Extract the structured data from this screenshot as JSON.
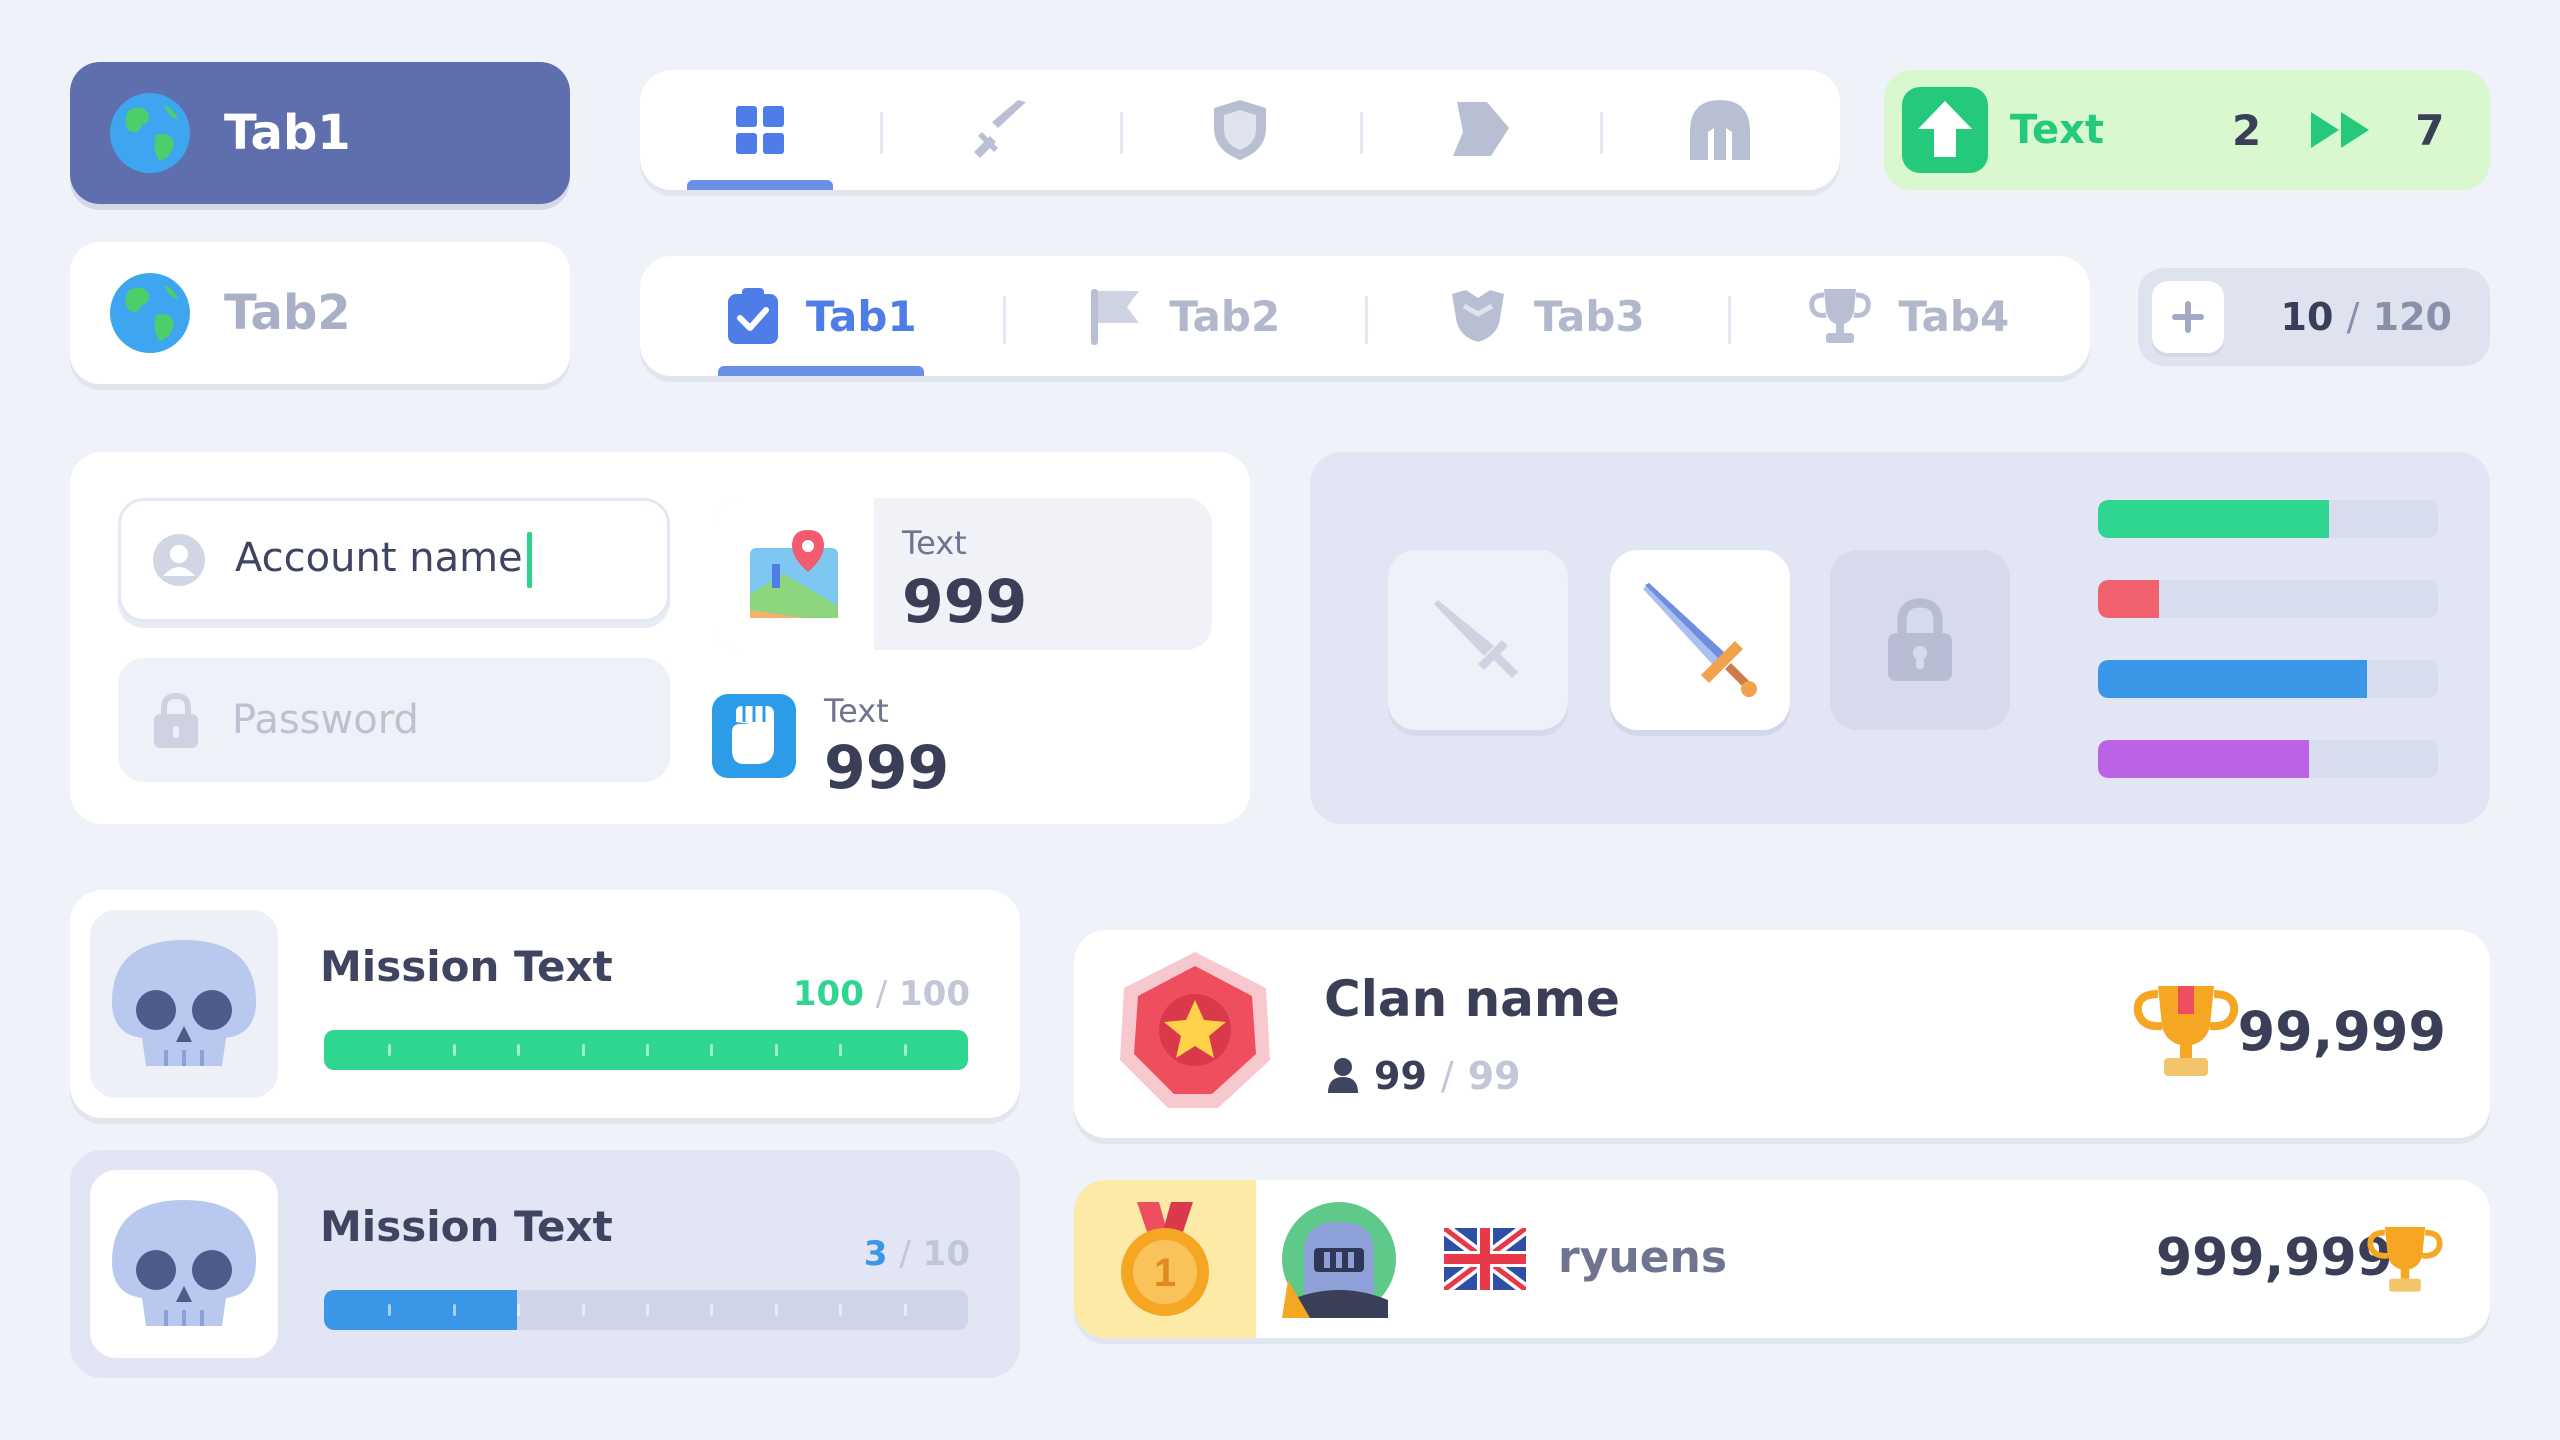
{
  "side_tabs": [
    {
      "label": "Tab1",
      "icon": "globe-icon",
      "active": true
    },
    {
      "label": "Tab2",
      "icon": "globe-icon",
      "active": false
    }
  ],
  "icon_tabs": [
    "grid-icon",
    "sword-icon",
    "shield-icon",
    "boot-icon",
    "helmet-icon"
  ],
  "text_tabs": [
    {
      "label": "Tab1",
      "icon": "clipboard-check-icon",
      "active": true
    },
    {
      "label": "Tab2",
      "icon": "flag-icon",
      "active": false
    },
    {
      "label": "Tab3",
      "icon": "armor-icon",
      "active": false
    },
    {
      "label": "Tab4",
      "icon": "trophy-icon",
      "active": false
    }
  ],
  "upgrade": {
    "label": "Text",
    "from": "2",
    "to": "7",
    "icon": "arrow-up-icon"
  },
  "counter": {
    "current": "10",
    "separator": "/",
    "max": "120",
    "icon": "plus-icon"
  },
  "form": {
    "account_value": "Account name",
    "password_placeholder": "Password"
  },
  "stats": [
    {
      "label": "Text",
      "value": "999",
      "icon": "map-icon"
    },
    {
      "label": "Text",
      "value": "999",
      "icon": "fist-icon"
    }
  ],
  "equipment": {
    "slots": [
      {
        "icon": "sword-icon",
        "state": "disabled"
      },
      {
        "icon": "sword-icon",
        "state": "selected"
      },
      {
        "icon": "lock-icon",
        "state": "locked"
      }
    ],
    "bars": [
      {
        "fill": 0.68,
        "color": "#2ed68f"
      },
      {
        "fill": 0.18,
        "color": "#f2626e"
      },
      {
        "fill": 0.79,
        "color": "#3a97e8"
      },
      {
        "fill": 0.62,
        "color": "#bb62e6"
      }
    ]
  },
  "missions": [
    {
      "title": "Mission Text",
      "current": "100",
      "separator": "/",
      "total": "100",
      "fill": 1.0,
      "color": "#2ed68f",
      "icon": "skull-icon"
    },
    {
      "title": "Mission Text",
      "current": "3",
      "separator": "/",
      "total": "10",
      "fill": 0.3,
      "color": "#3a97e8",
      "icon": "skull-icon"
    }
  ],
  "clan": {
    "name": "Clan name",
    "members_current": "99",
    "separator": "/",
    "members_max": "99",
    "trophies": "99,999",
    "badge_icon": "star-badge-icon"
  },
  "leader": {
    "rank": "1",
    "name": "ryuens",
    "score": "999,999",
    "flag_icon": "uk-flag-icon",
    "avatar_icon": "knight-avatar-icon"
  }
}
